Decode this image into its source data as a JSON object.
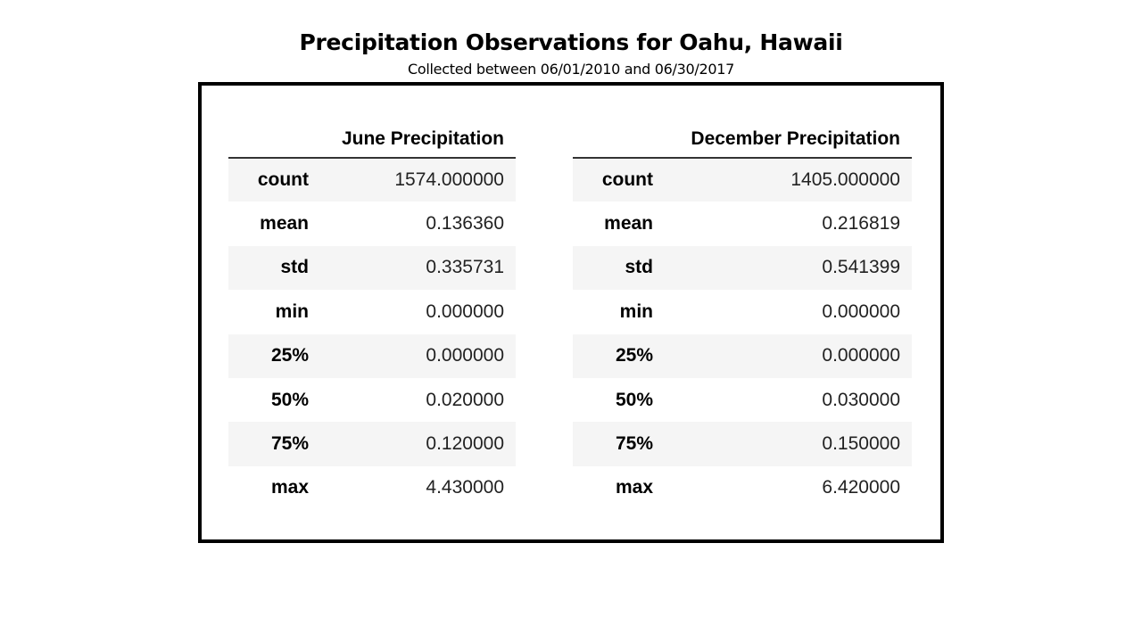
{
  "header": {
    "title": "Precipitation Observations for Oahu, Hawaii",
    "subtitle": "Collected between 06/01/2010 and 06/30/2017"
  },
  "tables": [
    {
      "column": "June Precipitation",
      "rows": [
        {
          "stat": "count",
          "value": "1574.000000"
        },
        {
          "stat": "mean",
          "value": "0.136360"
        },
        {
          "stat": "std",
          "value": "0.335731"
        },
        {
          "stat": "min",
          "value": "0.000000"
        },
        {
          "stat": "25%",
          "value": "0.000000"
        },
        {
          "stat": "50%",
          "value": "0.020000"
        },
        {
          "stat": "75%",
          "value": "0.120000"
        },
        {
          "stat": "max",
          "value": "4.430000"
        }
      ]
    },
    {
      "column": "December Precipitation",
      "rows": [
        {
          "stat": "count",
          "value": "1405.000000"
        },
        {
          "stat": "mean",
          "value": "0.216819"
        },
        {
          "stat": "std",
          "value": "0.541399"
        },
        {
          "stat": "min",
          "value": "0.000000"
        },
        {
          "stat": "25%",
          "value": "0.000000"
        },
        {
          "stat": "50%",
          "value": "0.030000"
        },
        {
          "stat": "75%",
          "value": "0.150000"
        },
        {
          "stat": "max",
          "value": "6.420000"
        }
      ]
    }
  ]
}
